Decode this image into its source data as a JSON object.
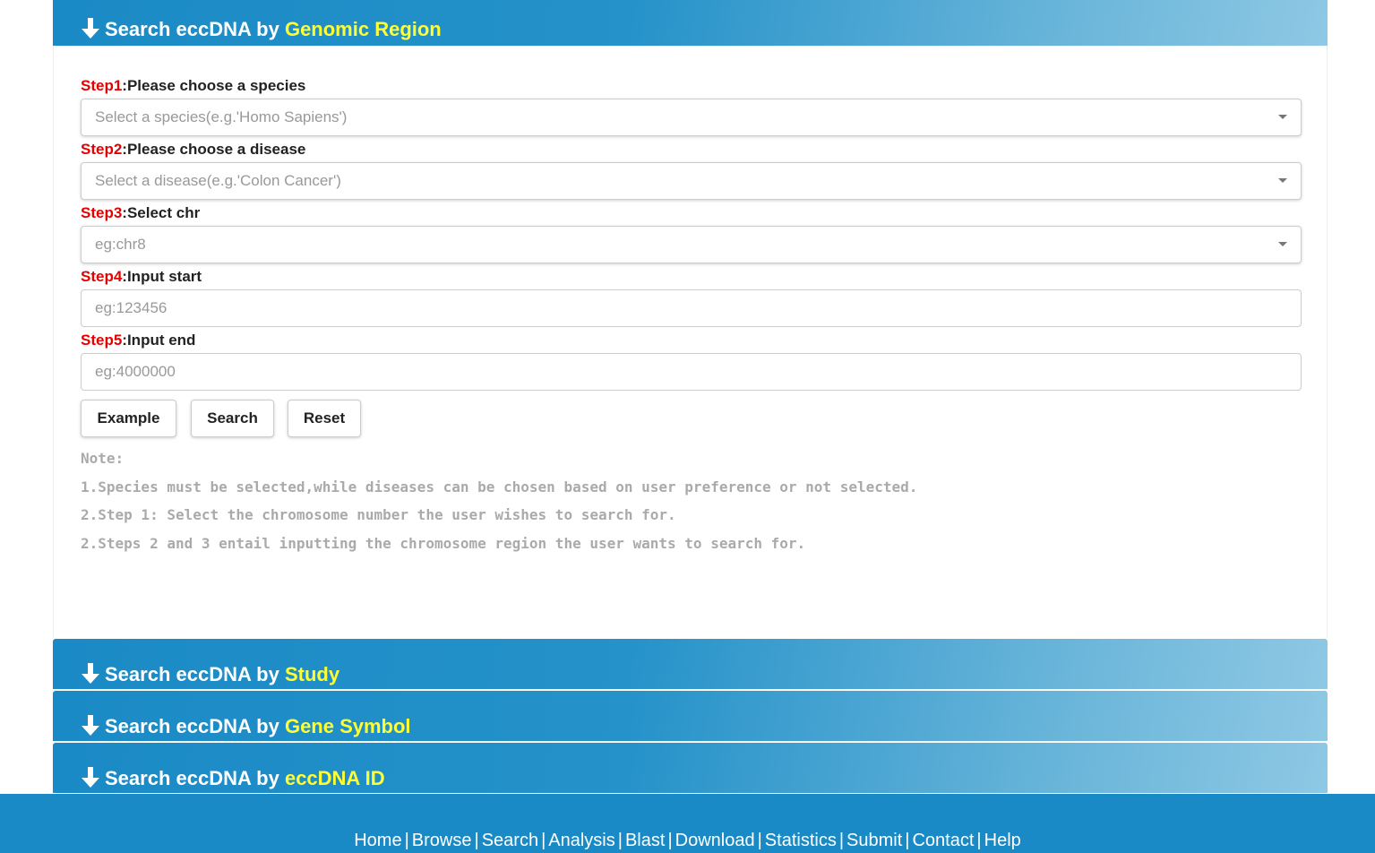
{
  "genomic_panel": {
    "prefix": "Search eccDNA by ",
    "highlight": "Genomic Region"
  },
  "steps": [
    {
      "num": "Step1",
      "text": ":Please choose a species",
      "placeholder": "Select a species(e.g.'Homo Sapiens')",
      "type": "select"
    },
    {
      "num": "Step2",
      "text": ":Please choose a disease",
      "placeholder": "Select a disease(e.g.'Colon Cancer')",
      "type": "select"
    },
    {
      "num": "Step3",
      "text": ":Select chr",
      "placeholder": "eg:chr8",
      "type": "select"
    },
    {
      "num": "Step4",
      "text": ":Input start",
      "placeholder": "eg:123456",
      "type": "input"
    },
    {
      "num": "Step5",
      "text": ":Input end",
      "placeholder": "eg:4000000",
      "type": "input"
    }
  ],
  "buttons": {
    "example": "Example",
    "search": "Search",
    "reset": "Reset"
  },
  "notes": {
    "title": "Note:",
    "lines": [
      "1.Species must be selected,while diseases can be chosen based on user preference or not selected.",
      "2.Step 1: Select the chromosome number the user wishes to search for.",
      "2.Steps 2 and 3 entail inputting the chromosome region the user wants to search for."
    ]
  },
  "collapsed_panels": [
    {
      "prefix": "Search eccDNA by ",
      "highlight": "Study"
    },
    {
      "prefix": "Search eccDNA by ",
      "highlight": "Gene Symbol"
    },
    {
      "prefix": "Search eccDNA by ",
      "highlight": "eccDNA ID"
    }
  ],
  "footer": {
    "links": [
      "Home",
      "Browse",
      "Search",
      "Analysis",
      "Blast",
      "Download",
      "Statistics",
      "Submit",
      "Contact",
      "Help"
    ],
    "separator": "|"
  },
  "colors": {
    "header_blue": "#1a8ac6",
    "highlight_yellow": "#ffff33",
    "step_red": "#e60000",
    "note_gray": "#aaaaaa"
  }
}
